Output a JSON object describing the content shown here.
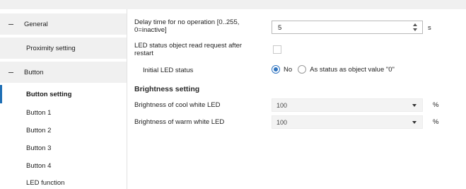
{
  "sidebar": {
    "items": [
      {
        "label": "General",
        "type": "group"
      },
      {
        "label": "Proximity setting",
        "type": "sub"
      },
      {
        "label": "Button",
        "type": "group"
      },
      {
        "label": "Button setting",
        "type": "active"
      },
      {
        "label": "Button 1",
        "type": "plain"
      },
      {
        "label": "Button 2",
        "type": "plain"
      },
      {
        "label": "Button 3",
        "type": "plain"
      },
      {
        "label": "Button 4",
        "type": "plain"
      },
      {
        "label": "LED function",
        "type": "plain"
      }
    ],
    "accent_color": "#1f6fb5"
  },
  "main": {
    "delay": {
      "label_line1": "Delay time for no operation [0..255,",
      "label_line2": "0=inactive]",
      "value": "5",
      "unit": "s"
    },
    "led_read": {
      "label_line1": "LED status object read request after",
      "label_line2": "restart",
      "checked": false
    },
    "initial_led": {
      "label": "Initial LED status",
      "options": [
        "No",
        "As status as object value \"0\""
      ],
      "selected": "No"
    },
    "brightness_section": "Brightness setting",
    "cool": {
      "label": "Brightness of cool white LED",
      "value": "100",
      "unit": "%"
    },
    "warm": {
      "label": "Brightness of warm white LED",
      "value": "100",
      "unit": "%"
    }
  }
}
